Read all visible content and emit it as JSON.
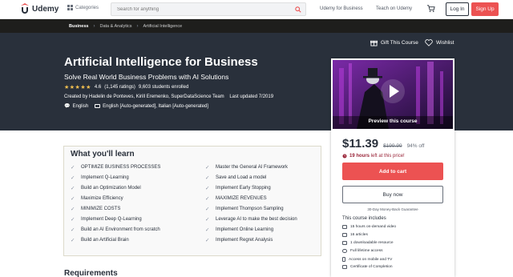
{
  "nav": {
    "brand": "Udemy",
    "categories": "Categories",
    "search_placeholder": "Search for anything",
    "udemy_business": "Udemy for Business",
    "teach": "Teach on Udemy",
    "login": "Log In",
    "signup": "Sign Up",
    "brand_color": "#ec5252"
  },
  "breadcrumbs": [
    "Business",
    "Data & Analytics",
    "Artificial Intelligence"
  ],
  "hero": {
    "gift": "Gift This Course",
    "wishlist": "Wishlist",
    "title": "Artificial Intelligence for Business",
    "subtitle": "Solve Real World Business Problems with AI Solutions",
    "rating": "4.6",
    "ratings_count": "(1,145 ratings)",
    "students": "9,603 students enrolled",
    "created_by": "Created by Hadelin de Ponteves, Kirill Eremenko, SuperDataScience Team",
    "last_updated": "Last updated 7/2019",
    "language": "English",
    "captions": "English [Auto-generated], Italian [Auto-generated]"
  },
  "card": {
    "preview_label": "Preview this course",
    "price": "$11.39",
    "old_price": "$199.99",
    "discount": "94% off",
    "hours_left_bold": "19 hours",
    "hours_left_rest": " left at this price!",
    "add_to_cart": "Add to cart",
    "buy_now": "Buy now",
    "guarantee": "30-Day Money-Back Guarantee",
    "includes_title": "This course includes",
    "includes": [
      "15 hours on-demand video",
      "16 articles",
      "1 downloadable resource",
      "Full lifetime access",
      "Access on mobile and TV",
      "Certificate of Completion"
    ]
  },
  "learn": {
    "title": "What you'll learn",
    "left": [
      "OPTIMIZE BUSINESS PROCESSES",
      "Implement Q-Learning",
      "Build an Optimization Model",
      "Maximize Efficiency",
      "MINIMIZE COSTS",
      "Implement Deep Q-Learning",
      "Build an AI Environment from scratch",
      "Build an Artificial Brain"
    ],
    "right": [
      "Master the General AI Framework",
      "Save and Load a model",
      "Implement Early Stopping",
      "MAXIMIZE REVENUES",
      "Implement Thompson Sampling",
      "Leverage AI to make the best decision",
      "Implement Online Learning",
      "Implement Regret Analysis"
    ]
  },
  "requirements_title": "Requirements"
}
